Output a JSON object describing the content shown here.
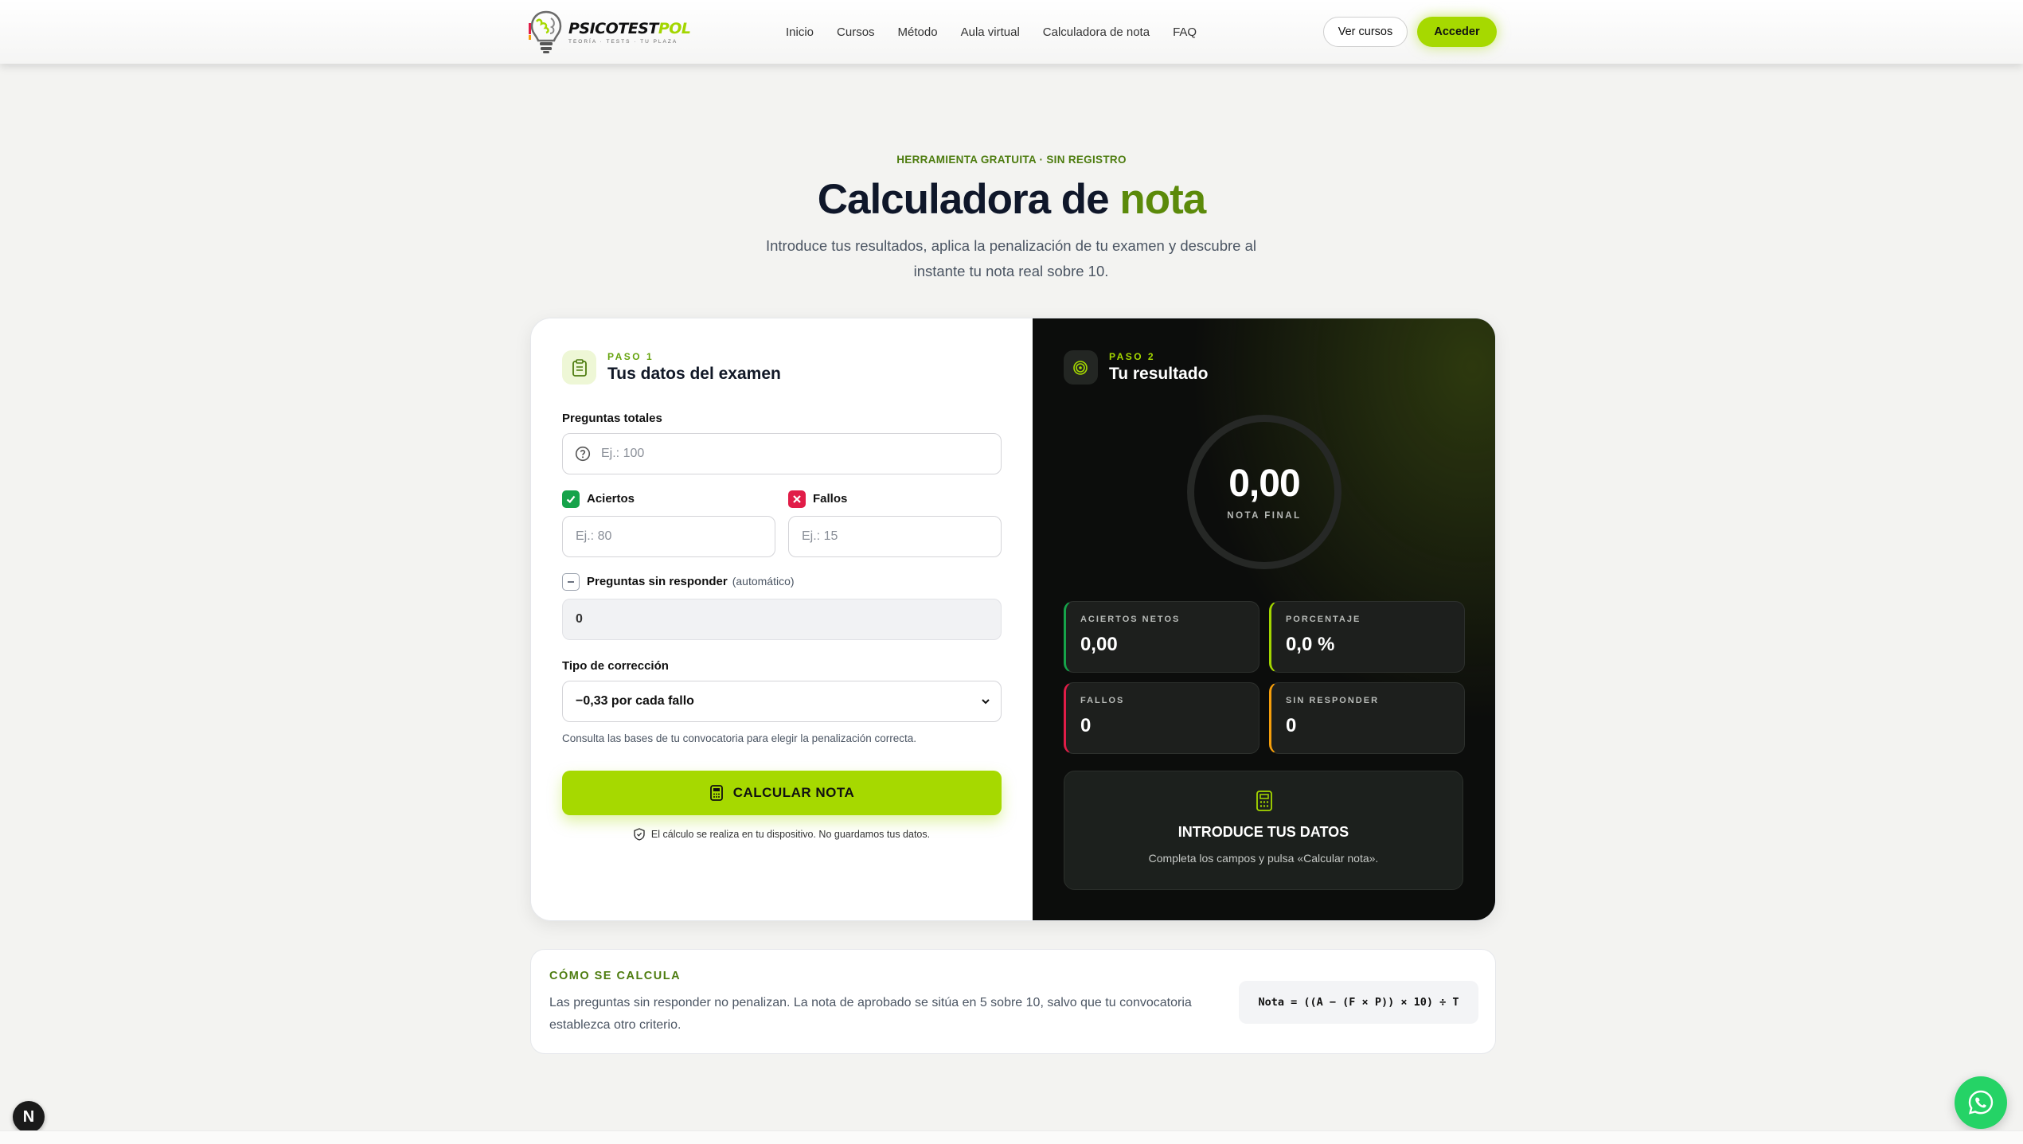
{
  "nav": {
    "brand_main": "PSICOTEST",
    "brand_accent": "POL",
    "tagline": "TEORÍA · TESTS · TU PLAZA",
    "links": [
      "Inicio",
      "Cursos",
      "Método",
      "Aula virtual",
      "Calculadora de nota",
      "FAQ"
    ],
    "ver_cursos": "Ver cursos",
    "acceder": "Acceder"
  },
  "hero": {
    "eyebrow": "HERRAMIENTA GRATUITA · SIN REGISTRO",
    "title_main": "Calculadora de",
    "title_accent": "nota",
    "subtitle": "Introduce tus resultados, aplica la penalización de tu examen y descubre al instante tu nota real sobre 10."
  },
  "form": {
    "step": "PASO 1",
    "title": "Tus datos del examen",
    "total_label": "Preguntas totales",
    "total_placeholder": "Ej.: 100",
    "aciertos_label": "Aciertos",
    "aciertos_placeholder": "Ej.: 80",
    "fallos_label": "Fallos",
    "fallos_placeholder": "Ej.: 15",
    "sin_label": "Preguntas sin responder",
    "sin_auto": "(automático)",
    "sin_value": "0",
    "correccion_label": "Tipo de corrección",
    "correccion_value": "−0,33 por cada fallo",
    "help": "Consulta las bases de tu convocatoria para elegir la penalización correcta.",
    "calc_button": "CALCULAR NOTA",
    "privacy": "El cálculo se realiza en tu dispositivo. No guardamos tus datos."
  },
  "result": {
    "step": "PASO 2",
    "title": "Tu resultado",
    "score": "0,00",
    "score_label": "NOTA FINAL",
    "stats": [
      {
        "label": "ACIERTOS NETOS",
        "value": "0,00",
        "color": "#16a34a"
      },
      {
        "label": "PORCENTAJE",
        "value": "0,0 %",
        "color": "#a3d600"
      },
      {
        "label": "FALLOS",
        "value": "0",
        "color": "#e11d48"
      },
      {
        "label": "SIN RESPONDER",
        "value": "0",
        "color": "#f59e0b"
      }
    ],
    "info_title": "INTRODUCE TUS DATOS",
    "info_desc": "Completa los campos y pulsa «Calcular nota»."
  },
  "how": {
    "heading": "CÓMO SE CALCULA",
    "text": "Las preguntas sin responder no penalizan. La nota de aprobado se sitúa en 5 sobre 10, salvo que tu convocatoria establezca otro criterio.",
    "formula": "Nota = ((A − (F × P)) × 10) ÷ T"
  },
  "colors": {
    "accent": "#a6d900",
    "accent_dark": "#5b8a0a",
    "dark_panel": "#0c0d0c"
  },
  "icons": {
    "next": "N",
    "whatsapp": "whatsapp-icon"
  }
}
